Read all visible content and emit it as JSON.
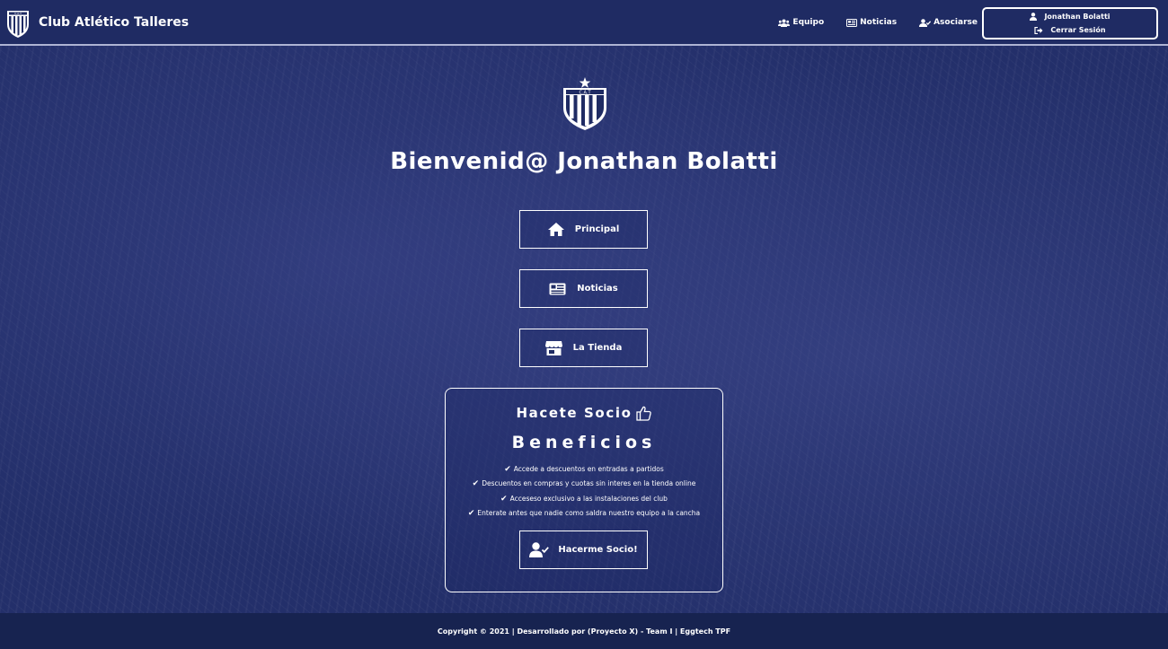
{
  "brand": {
    "name": "Club Atlético Talleres",
    "crest_text": "C.A.T"
  },
  "nav": {
    "items": [
      {
        "label": "Equipo",
        "icon": "users-icon"
      },
      {
        "label": "Noticias",
        "icon": "newspaper-icon"
      },
      {
        "label": "Asociarse",
        "icon": "user-check-icon"
      }
    ],
    "user": {
      "name": "Jonathan Bolatti",
      "logout": "Cerrar Sesión"
    }
  },
  "hero": {
    "crest_text": "C.A.T",
    "welcome": "Bienvenid@ Jonathan Bolatti"
  },
  "menu": [
    {
      "label": "Principal",
      "icon": "home-icon"
    },
    {
      "label": "Noticias",
      "icon": "newspaper-icon"
    },
    {
      "label": "La Tienda",
      "icon": "store-icon"
    }
  ],
  "socio": {
    "title": "Hacete Socio",
    "subtitle": "Beneficios",
    "benefits": [
      "Accede a descuentos en entradas a partidos",
      "Descuentos en compras y cuotas sin interes en la tienda online",
      "Acceseso exclusivo a las instalaciones del club",
      "Enterate antes que nadie como saldra nuestro equipo a la cancha"
    ],
    "button": "Hacerme Socio!"
  },
  "footer": {
    "text": "Copyright © 2021 | Desarrollado por (Proyecto X) - Team I | Eggtech TPF"
  },
  "colors": {
    "navbar": "#1f2b63",
    "background": "#232f6a",
    "footer": "#172350",
    "text": "#ffffff"
  }
}
